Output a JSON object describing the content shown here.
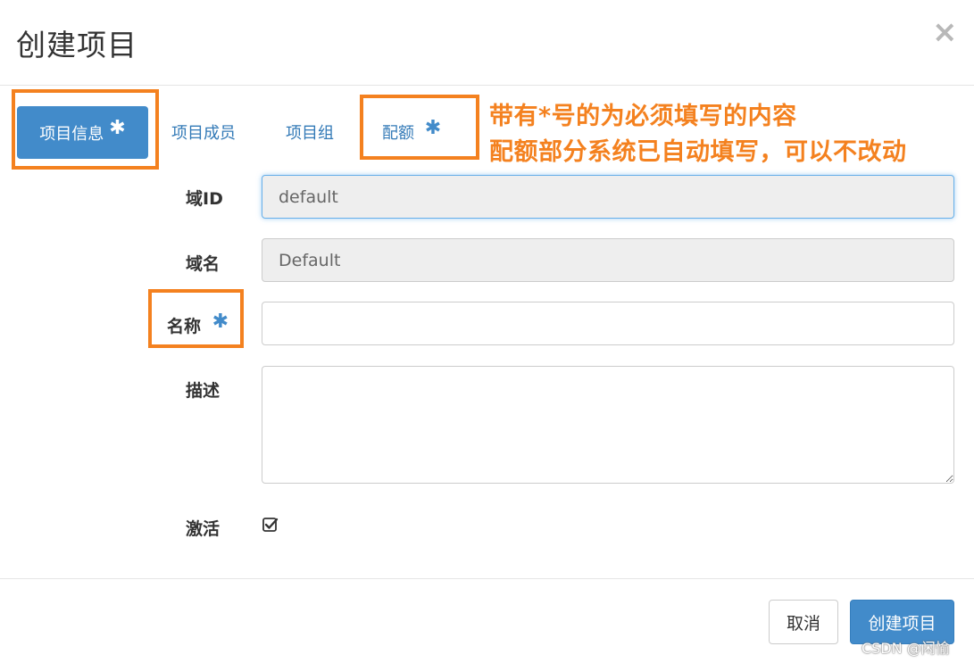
{
  "dialog": {
    "title": "创建项目",
    "close_glyph": "×"
  },
  "tabs": [
    {
      "label": "项目信息",
      "required_mark": "✱",
      "active": true
    },
    {
      "label": "项目成员"
    },
    {
      "label": "项目组"
    },
    {
      "label": "配额",
      "required_mark": "✱"
    }
  ],
  "annotation": {
    "line1": "带有*号的为必须填写的内容",
    "line2": "配额部分系统已自动填写，可以不改动",
    "color": "#f4811f"
  },
  "form": {
    "domain_id": {
      "label": "域ID",
      "value": "default"
    },
    "domain_name": {
      "label": "域名",
      "value": "Default"
    },
    "name": {
      "label": "名称",
      "required_mark": "✱",
      "value": ""
    },
    "description": {
      "label": "描述",
      "value": ""
    },
    "enabled": {
      "label": "激活",
      "checked": true
    }
  },
  "footer": {
    "cancel_label": "取消",
    "create_label": "创建项目"
  },
  "watermark": "CSDN @闲愉",
  "colors": {
    "primary": "#428bca",
    "link": "#337ab7",
    "highlight": "#f4811f",
    "readonly_bg": "#eeeeee"
  }
}
